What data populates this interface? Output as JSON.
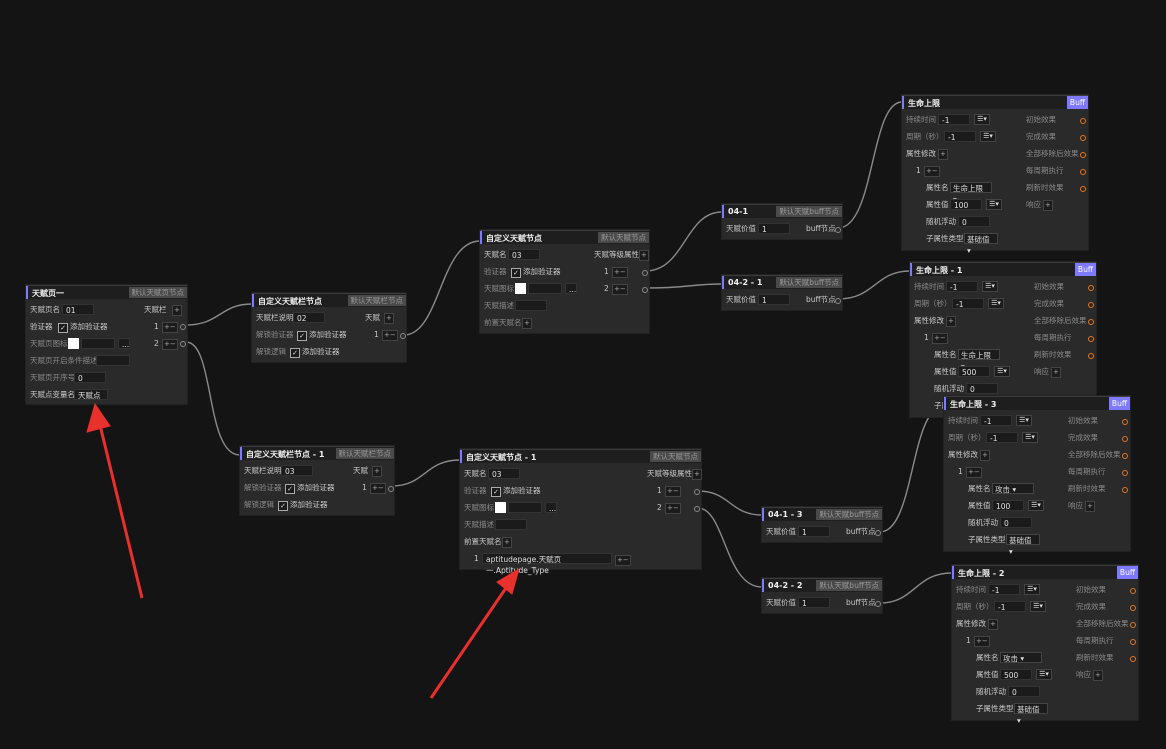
{
  "colors": {
    "accent": "#7d7aff",
    "arrow": "#e8302d",
    "canvas": "#141414",
    "node": "#2a2a2a",
    "port_orange": "#e8741c"
  },
  "page_node": {
    "title": "天赋页一",
    "tag": "默认天赋页节点",
    "rows": {
      "name_label": "天赋页名",
      "name_value": "01",
      "validator_label": "验证器",
      "validator_btn": "添加验证器",
      "icon_label": "天赋页图标",
      "icon_btn": "...",
      "cond_label": "天赋页开启条件描述",
      "order_label": "天赋页开序号",
      "order_value": "0",
      "var_label": "天赋点变量名",
      "var_value": "天赋点"
    },
    "bar_label": "天赋栏",
    "bar_1": "1",
    "bar_2": "2",
    "plusminus": "+−"
  },
  "bar_node_a": {
    "title": "自定义天赋栏节点",
    "tag": "默认天赋栏节点",
    "desc_label": "天赋栏说明",
    "desc_value": "02",
    "unlock_validator_label": "解锁验证器",
    "unlock_validator_btn": "添加验证器",
    "unlock_logic_label": "解锁逻辑",
    "unlock_logic_btn": "添加验证器",
    "talent_label": "天赋",
    "talent_1": "1"
  },
  "bar_node_b": {
    "title": "自定义天赋栏节点 - 1",
    "tag": "默认天赋栏节点",
    "desc_label": "天赋栏说明",
    "desc_value": "03",
    "unlock_validator_label": "解锁验证器",
    "unlock_validator_btn": "添加验证器",
    "unlock_logic_label": "解锁逻辑",
    "unlock_logic_btn": "添加验证器",
    "talent_label": "天赋",
    "talent_1": "1"
  },
  "talent_node_a": {
    "title": "自定义天赋节点",
    "tag": "默认天赋节点",
    "name_label": "天赋名",
    "name_value": "03",
    "validator_label": "验证器",
    "validator_btn": "添加验证器",
    "icon_label": "天赋图标",
    "icon_btn": "...",
    "desc_label": "天赋描述",
    "pre_label": "前置天赋名",
    "level_label": "天赋等级属性",
    "level_1": "1",
    "level_2": "2"
  },
  "talent_node_b": {
    "title": "自定义天赋节点 - 1",
    "tag": "默认天赋节点",
    "name_label": "天赋名",
    "name_value": "03",
    "validator_label": "验证器",
    "validator_btn": "添加验证器",
    "icon_label": "天赋图标",
    "icon_btn": "...",
    "desc_label": "天赋描述",
    "pre_label": "前置天赋名",
    "pre_1": "1",
    "pre_1_value": "aptitudepage.天赋页一.Aptitude_Type",
    "level_label": "天赋等级属性",
    "level_1": "1",
    "level_2": "2"
  },
  "value_nodes": [
    {
      "title": "04-1",
      "tag": "默认天赋buff节点",
      "value_label": "天赋价值",
      "value": "1",
      "buff_label": "buff节点"
    },
    {
      "title": "04-2 - 1",
      "tag": "默认天赋buff节点",
      "value_label": "天赋价值",
      "value": "1",
      "buff_label": "buff节点"
    },
    {
      "title": "04-1 - 3",
      "tag": "默认天赋buff节点",
      "value_label": "天赋价值",
      "value": "1",
      "buff_label": "buff节点"
    },
    {
      "title": "04-2 - 2",
      "tag": "默认天赋buff节点",
      "value_label": "天赋价值",
      "value": "1",
      "buff_label": "buff节点"
    }
  ],
  "buff_nodes": [
    {
      "title": "生命上限",
      "badge": "Buff",
      "duration_label": "持续时间",
      "duration": "-1",
      "period_label": "周期（秒）",
      "period": "-1",
      "modify_label": "属性修改",
      "idx": "1",
      "attr_name_label": "属性名",
      "attr_name": "生命上限",
      "attr_val_label": "属性值",
      "attr_val": "100",
      "rand_label": "随机浮动",
      "rand": "0",
      "sub_label": "子属性类型",
      "sub": "基础值",
      "effects": [
        "初始效果",
        "完成效果",
        "全部移除后效果",
        "每周期执行",
        "刷新时效果"
      ],
      "respond": "响应"
    },
    {
      "title": "生命上限 - 1",
      "badge": "Buff",
      "duration_label": "持续时间",
      "duration": "-1",
      "period_label": "周期（秒）",
      "period": "-1",
      "modify_label": "属性修改",
      "idx": "1",
      "attr_name_label": "属性名",
      "attr_name": "生命上限",
      "attr_val_label": "属性值",
      "attr_val": "500",
      "rand_label": "随机浮动",
      "rand": "0",
      "sub_label": "子属性类型",
      "sub": "基础值",
      "effects": [
        "初始效果",
        "完成效果",
        "全部移除后效果",
        "每周期执行",
        "刷新时效果"
      ],
      "respond": "响应"
    },
    {
      "title": "生命上限 - 3",
      "badge": "Buff",
      "duration_label": "持续时间",
      "duration": "-1",
      "period_label": "周期（秒）",
      "period": "-1",
      "modify_label": "属性修改",
      "idx": "1",
      "attr_name_label": "属性名",
      "attr_name": "攻击",
      "attr_val_label": "属性值",
      "attr_val": "100",
      "rand_label": "随机浮动",
      "rand": "0",
      "sub_label": "子属性类型",
      "sub": "基础值",
      "effects": [
        "初始效果",
        "完成效果",
        "全部移除后效果",
        "每周期执行",
        "刷新时效果"
      ],
      "respond": "响应"
    },
    {
      "title": "生命上限 - 2",
      "badge": "Buff",
      "duration_label": "持续时间",
      "duration": "-1",
      "period_label": "周期（秒）",
      "period": "-1",
      "modify_label": "属性修改",
      "idx": "1",
      "attr_name_label": "属性名",
      "attr_name": "攻击",
      "attr_val_label": "属性值",
      "attr_val": "500",
      "rand_label": "随机浮动",
      "rand": "0",
      "sub_label": "子属性类型",
      "sub": "基础值",
      "effects": [
        "初始效果",
        "完成效果",
        "全部移除后效果",
        "每周期执行",
        "刷新时效果"
      ],
      "respond": "响应"
    }
  ]
}
